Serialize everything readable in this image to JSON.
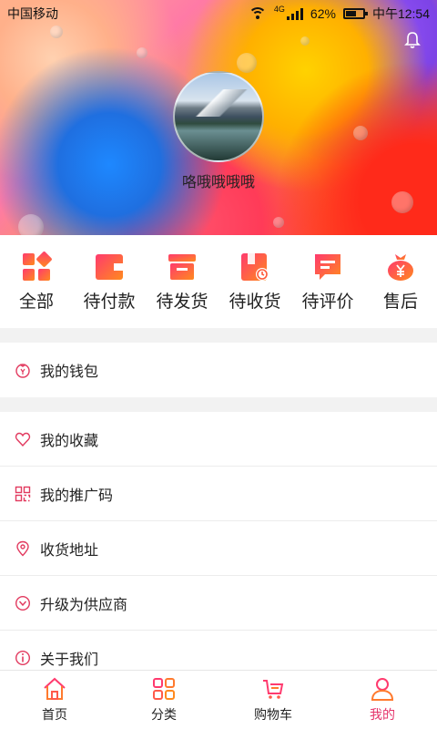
{
  "status_bar": {
    "carrier": "中国移动",
    "network": "4G",
    "battery": "62%",
    "battery_level": 0.62,
    "time": "中午12:54"
  },
  "profile": {
    "nickname": "咯哦哦哦哦"
  },
  "orders": [
    {
      "label": "全部",
      "icon": "grid-icon"
    },
    {
      "label": "待付款",
      "icon": "wallet-icon"
    },
    {
      "label": "待发货",
      "icon": "box-icon"
    },
    {
      "label": "待收货",
      "icon": "package-clock-icon"
    },
    {
      "label": "待评价",
      "icon": "comment-icon"
    },
    {
      "label": "售后",
      "icon": "money-bag-icon"
    }
  ],
  "menu": {
    "wallet": "我的钱包",
    "favorites": "我的收藏",
    "promo_code": "我的推广码",
    "address": "收货地址",
    "supplier": "升级为供应商",
    "about": "关于我们"
  },
  "tabbar": [
    {
      "label": "首页",
      "icon": "home-icon",
      "active": false
    },
    {
      "label": "分类",
      "icon": "category-icon",
      "active": false
    },
    {
      "label": "购物车",
      "icon": "cart-icon",
      "active": false
    },
    {
      "label": "我的",
      "icon": "user-icon",
      "active": true
    }
  ],
  "colors": {
    "accent": "#e5336a",
    "icon_gradient_start": "#ff3a6e",
    "icon_gradient_end": "#ff8a1e"
  }
}
